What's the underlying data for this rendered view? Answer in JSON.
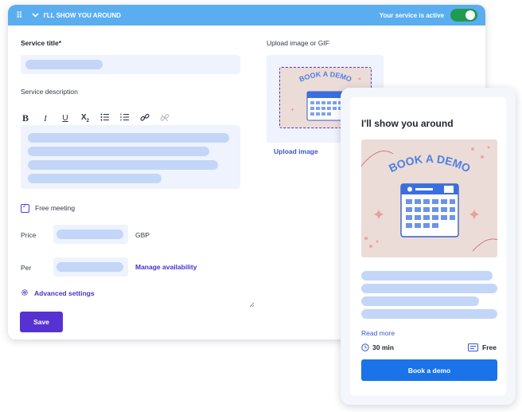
{
  "topbar": {
    "title": "I'LL SHOW YOU AROUND",
    "status_label": "Your service is active",
    "toggle_on": true
  },
  "form": {
    "service_title_label": "Service title*",
    "service_description_label": "Service description",
    "toolbar_icons": [
      "bold-icon",
      "italic-icon",
      "underline-icon",
      "subscript-icon",
      "bulleted-list-icon",
      "numbered-list-icon",
      "link-icon",
      "unlink-icon"
    ],
    "free_meeting_label": "Free meeting",
    "free_meeting_checked": true,
    "price_label": "Price",
    "currency": "GBP",
    "per_label": "Per",
    "manage_availability": "Manage availability",
    "advanced_settings": "Advanced settings",
    "save_label": "Save"
  },
  "upload": {
    "label": "Upload image or GIF",
    "link": "Upload image",
    "image_text": "BOOK A DEMO"
  },
  "preview": {
    "title": "I'll show you around",
    "image_text": "BOOK A DEMO",
    "read_more": "Read more",
    "duration": "30 min",
    "price": "Free",
    "book_label": "Book a demo"
  },
  "colors": {
    "topbar": "#5aaef0",
    "toggle": "#1f9b4e",
    "accent": "#5632d2",
    "book_button": "#1a73e8",
    "placeholder": "#c3d6f8"
  }
}
